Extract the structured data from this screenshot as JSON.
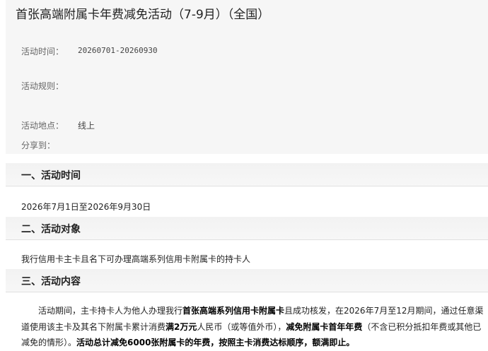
{
  "page": {
    "title": "首张高端附属卡年费减免活动（7-9月）（全国）"
  },
  "info": {
    "time_label": "活动时间：",
    "time_value": "20260701-20260930",
    "rules_label": "活动规则：",
    "location_label": "活动地点：",
    "location_value": "线上",
    "share_label": "分享到："
  },
  "sections": [
    {
      "heading": "一、活动时间",
      "body": "2026年7月1日至2026年9月30日"
    },
    {
      "heading": "二、活动对象",
      "body": "我行信用卡主卡且名下可办理高端系列信用卡附属卡的持卡人"
    },
    {
      "heading": "三、活动内容"
    }
  ],
  "content": {
    "seg1": "活动期间，主卡持卡人为他人办理我行",
    "seg2": "首张高端系列信用卡附属卡",
    "seg3": "且成功核发，在2026年7月至12月期间，通过任意渠道使用该主卡及其名下附属卡累计消费",
    "seg4": "满2万元",
    "seg5": "人民币（或等值外币），",
    "seg6": "减免附属卡首年年费",
    "seg7": "（不含已积分抵扣年费或其他已减免的情形）。",
    "seg8": "活动总计减免6000张附属卡的年费，按照主卡消费达标顺序，额满即止。"
  }
}
